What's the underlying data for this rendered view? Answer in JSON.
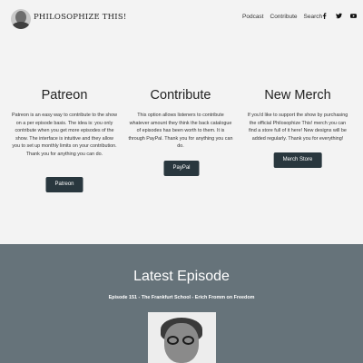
{
  "header": {
    "site_title": "PHILOSOPHIZE THIS!",
    "nav": [
      "Podcast",
      "Contribute",
      "Search"
    ],
    "social_icons": [
      "facebook-icon",
      "twitter-icon",
      "youtube-icon"
    ]
  },
  "cards": [
    {
      "title": "Patreon",
      "text": "Patreon is an easy way to contribute to the show on a per episode basis. The idea is: you only contribute when you get more episodes of the show. The interface is intuitive and they allow you to set up monthly limits on your contribution. Thank you for anything you can do.",
      "button": "Patreon"
    },
    {
      "title": "Contribute",
      "text": "This option allows listeners to contribute whatever amount they think the back catalogue of episodes has been worth to them. It is through PayPal. Thank you for anything you can do.",
      "button": "PayPal"
    },
    {
      "title": "New Merch",
      "text": "If you'd like to support the show by purchasing the official Philosophize This! merch you can find a store full of it here! New designs will be added regularly. Thank you for everything!",
      "button": "Merch Store"
    }
  ],
  "latest": {
    "heading": "Latest Episode",
    "episode": "Episode 151 - The Frankfurt School - Erich Fromm on Freedom"
  },
  "colors": {
    "background": "#f3f3f3",
    "button": "#29373e",
    "latest_band": "#66737a"
  }
}
